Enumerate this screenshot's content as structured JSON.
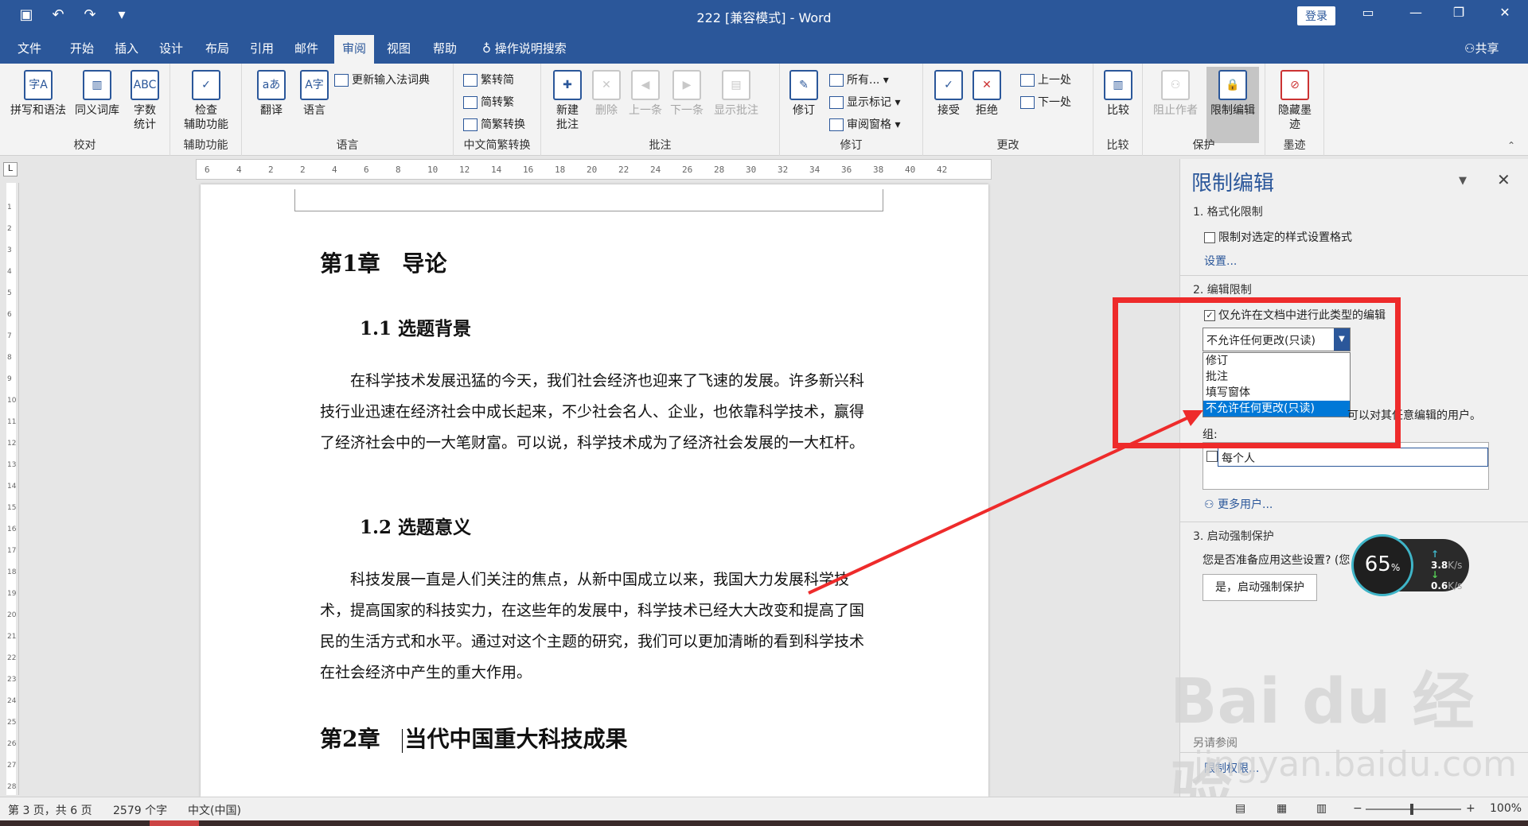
{
  "window": {
    "title": "222 [兼容模式] - Word",
    "login_label": "登录",
    "qat_icons": [
      "save-icon",
      "undo-icon",
      "redo-icon",
      "customize-icon"
    ]
  },
  "menu": {
    "tabs": [
      "文件",
      "开始",
      "插入",
      "设计",
      "布局",
      "引用",
      "邮件",
      "审阅",
      "视图",
      "帮助"
    ],
    "active_tab": "审阅",
    "search_label": "操作说明搜索",
    "share_label": "共享"
  },
  "ribbon": {
    "groups": {
      "proofing": {
        "label": "校对",
        "spelling": "拼写和语法",
        "thesaurus": "同义词库",
        "wordcount_1": "字数",
        "wordcount_2": "统计"
      },
      "accessibility": {
        "label": "辅助功能",
        "check_1": "检查",
        "check_2": "辅助功能"
      },
      "language": {
        "label": "语言",
        "translate": "翻译",
        "language": "语言",
        "update_ime": "更新输入法词典"
      },
      "chinese": {
        "label": "中文简繁转换",
        "to_simplified": "繁转简",
        "to_traditional": "简转繁",
        "convert": "简繁转换"
      },
      "comments": {
        "label": "批注",
        "new_1": "新建",
        "new_2": "批注",
        "delete": "删除",
        "prev": "上一条",
        "next": "下一条",
        "show": "显示批注"
      },
      "tracking": {
        "label": "修订",
        "track": "修订",
        "markup": "所有...",
        "show_markup": "显示标记",
        "pane": "审阅窗格"
      },
      "changes": {
        "label": "更改",
        "accept": "接受",
        "reject": "拒绝",
        "prev": "上一处",
        "next": "下一处"
      },
      "compare": {
        "label": "比较",
        "compare": "比较"
      },
      "protect": {
        "label": "保护",
        "block": "阻止作者",
        "restrict": "限制编辑"
      },
      "ink": {
        "label": "墨迹",
        "hide_1": "隐藏墨",
        "hide_2": "迹"
      }
    }
  },
  "ruler": {
    "horizontal_ticks": [
      "6",
      "4",
      "2",
      "2",
      "4",
      "6",
      "8",
      "10",
      "12",
      "14",
      "16",
      "18",
      "20",
      "22",
      "24",
      "26",
      "28",
      "30",
      "32",
      "34",
      "36",
      "38",
      "40",
      "42"
    ],
    "vertical_ticks": [
      "1",
      "2",
      "3",
      "4",
      "5",
      "6",
      "7",
      "8",
      "9",
      "10",
      "11",
      "12",
      "13",
      "14",
      "15",
      "16",
      "17",
      "18",
      "19",
      "20",
      "21",
      "22",
      "23",
      "24",
      "25",
      "26",
      "27",
      "28"
    ]
  },
  "document": {
    "chapter1": "第1章　导论",
    "section1_1": "1.1 选题背景",
    "para1": "在科学技术发展迅猛的今天，我们社会经济也迎来了飞速的发展。许多新兴科技行业迅速在经济社会中成长起来，不少社会名人、企业，也依靠科学技术，赢得了经济社会中的一大笔财富。可以说，科学技术成为了经济社会发展的一大杠杆。",
    "section1_2": "1.2 选题意义",
    "para2": "科技发展一直是人们关注的焦点，从新中国成立以来，我国大力发展科学技术，提高国家的科技实力，在这些年的发展中，科学技术已经大大改变和提高了国民的生活方式和水平。通过对这个主题的研究，我们可以更加清晰的看到科学技术在社会经济中产生的重大作用。",
    "chapter2_num": "第2章",
    "chapter2_title": "当代中国重大科技成果"
  },
  "pane": {
    "title": "限制编辑",
    "s1": "1. 格式化限制",
    "s1_check": "限制对选定的样式设置格式",
    "s1_link": "设置...",
    "s2": "2. 编辑限制",
    "s2_check": "仅允许在文档中进行此类型的编辑",
    "combo_value": "不允许任何更改(只读)",
    "options": [
      "修订",
      "批注",
      "填写窗体",
      "不允许任何更改(只读)"
    ],
    "selected_option": "不允许任何更改(只读)",
    "exceptions_tail": "可以对其任意编辑的用户。",
    "groups_label": "组:",
    "everyone": "每个人",
    "more_users": "更多用户...",
    "s3": "3. 启动强制保护",
    "s3_question": "您是否准备应用这些设置? (您",
    "start_button": "是，启动强制保护",
    "also_see": "另请参阅",
    "restrict_perm": "限制权限..."
  },
  "speed_widget": {
    "percent": "65",
    "percent_sign": "%",
    "up": "3.8",
    "down": "0.6",
    "unit": "K/s"
  },
  "watermark": {
    "brand": "Bai du 经验",
    "url": "jingyan.baidu.com"
  },
  "status": {
    "page": "第 3 页，共 6 页",
    "words": "2579 个字",
    "language": "中文(中国)",
    "zoom": "100%"
  },
  "colors": {
    "accent": "#2b579a",
    "highlight": "#ee2b2b",
    "selected_option": "#0078d7"
  }
}
